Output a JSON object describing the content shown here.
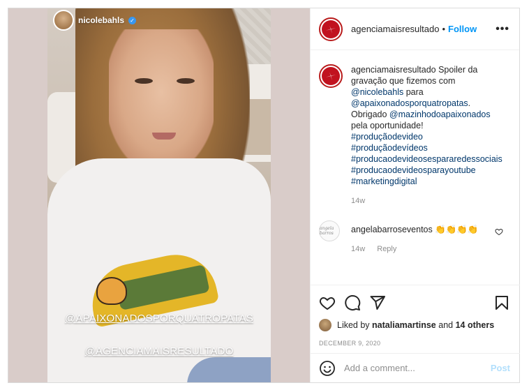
{
  "story": {
    "username": "nicolebahls",
    "tag1": "@APAIXONADOSPORQUATROPATAS",
    "tag2": "@AGENCIAMAISRESULTADO"
  },
  "header": {
    "username": "agenciamaisresultado",
    "separator": "•",
    "follow_label": "Follow",
    "more_label": "•••"
  },
  "caption": {
    "username": "agenciamaisresultado",
    "text1": " Spoiler da gravação que fizemos com ",
    "mention1": "@nicolebahls",
    "text2": " para ",
    "mention2": "@apaixonadosporquatropatas",
    "text3": ". Obrigado ",
    "mention3": "@mazinhodoapaixonados",
    "text4": " pela oportunidade!",
    "hashtags": [
      "#produçãodevideo",
      "#produçãodevídeos",
      "#producaodevideosespararedessociais",
      "#producaodevideosparayoutube",
      "#marketingdigital"
    ],
    "age": "14w"
  },
  "comment": {
    "avatar_text": "angela barros",
    "username": "angelabarroseventos",
    "text": " 👏👏👏👏",
    "age": "14w",
    "reply_label": "Reply"
  },
  "actions": {
    "liked_by_prefix": "Liked by ",
    "liked_user": "nataliamartinse",
    "and": " and ",
    "others": "14 others",
    "date": "DECEMBER 9, 2020"
  },
  "add_comment": {
    "placeholder": "Add a comment...",
    "post_label": "Post"
  },
  "colors": {
    "link": "#00376b",
    "follow": "#0095f6",
    "post_disabled": "#b2dffc",
    "brand_red": "#c1121f"
  },
  "icons": [
    "verified-icon",
    "more-options-icon",
    "heart-icon",
    "comment-icon",
    "share-icon",
    "bookmark-icon",
    "emoji-icon",
    "heart-small-icon"
  ]
}
